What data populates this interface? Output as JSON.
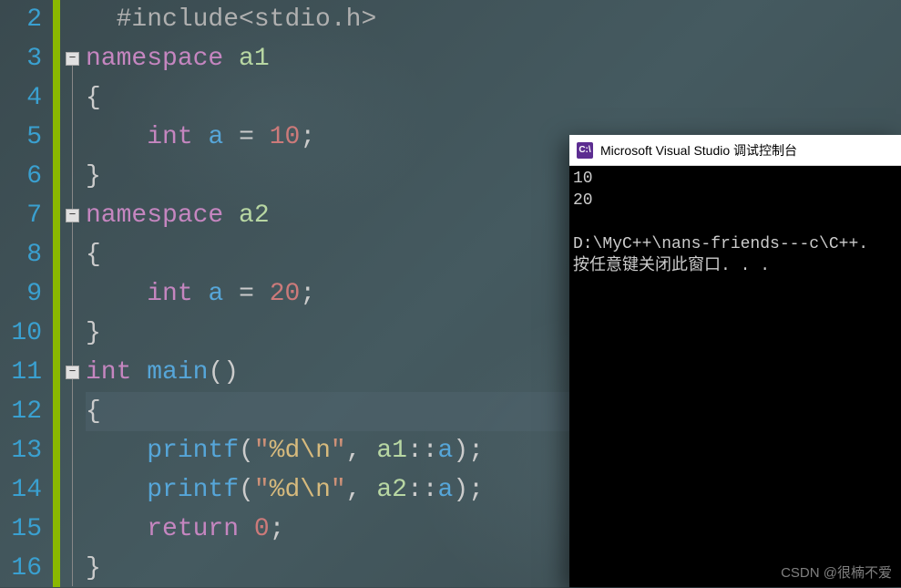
{
  "editor": {
    "line_start": 2,
    "lines": [
      {
        "n": 2,
        "fold": null,
        "tokens": [
          {
            "c": "tok-inc",
            "t": "#include"
          },
          {
            "c": "tok-inc",
            "t": "<stdio.h>"
          }
        ],
        "indent": "  "
      },
      {
        "n": 3,
        "fold": "-",
        "tokens": [
          {
            "c": "tok-kw",
            "t": "namespace"
          },
          {
            "c": "",
            "t": " "
          },
          {
            "c": "tok-ns",
            "t": "a1"
          }
        ],
        "indent": ""
      },
      {
        "n": 4,
        "fold": null,
        "tokens": [
          {
            "c": "tok-pun",
            "t": "{"
          }
        ],
        "indent": ""
      },
      {
        "n": 5,
        "fold": null,
        "tokens": [
          {
            "c": "tok-kw",
            "t": "int"
          },
          {
            "c": "",
            "t": " "
          },
          {
            "c": "tok-ident",
            "t": "a"
          },
          {
            "c": "",
            "t": " "
          },
          {
            "c": "tok-pun",
            "t": "="
          },
          {
            "c": "",
            "t": " "
          },
          {
            "c": "tok-num",
            "t": "10"
          },
          {
            "c": "tok-pun",
            "t": ";"
          }
        ],
        "indent": "    "
      },
      {
        "n": 6,
        "fold": null,
        "tokens": [
          {
            "c": "tok-pun",
            "t": "}"
          }
        ],
        "indent": ""
      },
      {
        "n": 7,
        "fold": "-",
        "tokens": [
          {
            "c": "tok-kw",
            "t": "namespace"
          },
          {
            "c": "",
            "t": " "
          },
          {
            "c": "tok-ns",
            "t": "a2"
          }
        ],
        "indent": ""
      },
      {
        "n": 8,
        "fold": null,
        "tokens": [
          {
            "c": "tok-pun",
            "t": "{"
          }
        ],
        "indent": ""
      },
      {
        "n": 9,
        "fold": null,
        "tokens": [
          {
            "c": "tok-kw",
            "t": "int"
          },
          {
            "c": "",
            "t": " "
          },
          {
            "c": "tok-ident",
            "t": "a"
          },
          {
            "c": "",
            "t": " "
          },
          {
            "c": "tok-pun",
            "t": "="
          },
          {
            "c": "",
            "t": " "
          },
          {
            "c": "tok-num",
            "t": "20"
          },
          {
            "c": "tok-pun",
            "t": ";"
          }
        ],
        "indent": "    "
      },
      {
        "n": 10,
        "fold": null,
        "tokens": [
          {
            "c": "tok-pun",
            "t": "}"
          }
        ],
        "indent": ""
      },
      {
        "n": 11,
        "fold": "-",
        "tokens": [
          {
            "c": "tok-kw",
            "t": "int"
          },
          {
            "c": "",
            "t": " "
          },
          {
            "c": "tok-ident",
            "t": "main"
          },
          {
            "c": "tok-pun",
            "t": "()"
          }
        ],
        "indent": ""
      },
      {
        "n": 12,
        "fold": null,
        "hl": true,
        "tokens": [
          {
            "c": "tok-pun",
            "t": "{"
          }
        ],
        "indent": ""
      },
      {
        "n": 13,
        "fold": null,
        "tokens": [
          {
            "c": "tok-ident",
            "t": "printf"
          },
          {
            "c": "tok-pun",
            "t": "("
          },
          {
            "c": "tok-str",
            "t": "\""
          },
          {
            "c": "tok-esc",
            "t": "%d"
          },
          {
            "c": "tok-esc",
            "t": "\\n"
          },
          {
            "c": "tok-str",
            "t": "\""
          },
          {
            "c": "tok-pun",
            "t": ","
          },
          {
            "c": "",
            "t": " "
          },
          {
            "c": "tok-ns",
            "t": "a1"
          },
          {
            "c": "tok-pun",
            "t": "::"
          },
          {
            "c": "tok-ident",
            "t": "a"
          },
          {
            "c": "tok-pun",
            "t": ");"
          }
        ],
        "indent": "    "
      },
      {
        "n": 14,
        "fold": null,
        "tokens": [
          {
            "c": "tok-ident",
            "t": "printf"
          },
          {
            "c": "tok-pun",
            "t": "("
          },
          {
            "c": "tok-str",
            "t": "\""
          },
          {
            "c": "tok-esc",
            "t": "%d"
          },
          {
            "c": "tok-esc",
            "t": "\\n"
          },
          {
            "c": "tok-str",
            "t": "\""
          },
          {
            "c": "tok-pun",
            "t": ","
          },
          {
            "c": "",
            "t": " "
          },
          {
            "c": "tok-ns",
            "t": "a2"
          },
          {
            "c": "tok-pun",
            "t": "::"
          },
          {
            "c": "tok-ident",
            "t": "a"
          },
          {
            "c": "tok-pun",
            "t": ");"
          }
        ],
        "indent": "    "
      },
      {
        "n": 15,
        "fold": null,
        "tokens": [
          {
            "c": "tok-kw",
            "t": "return"
          },
          {
            "c": "",
            "t": " "
          },
          {
            "c": "tok-num",
            "t": "0"
          },
          {
            "c": "tok-pun",
            "t": ";"
          }
        ],
        "indent": "    "
      },
      {
        "n": 16,
        "fold": null,
        "tokens": [
          {
            "c": "tok-pun",
            "t": "}"
          }
        ],
        "indent": ""
      }
    ]
  },
  "console": {
    "title": "Microsoft Visual Studio 调试控制台",
    "icon_text": "C:\\",
    "output": "10\n20\n\nD:\\MyC++\\nans-friends---c\\C++.\n按任意键关闭此窗口. . ."
  },
  "watermark": "CSDN @很楠不爱"
}
